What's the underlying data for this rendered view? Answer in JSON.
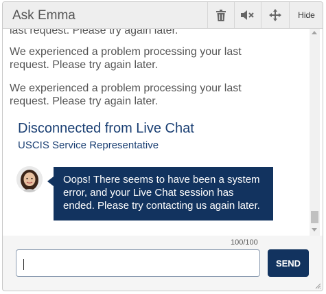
{
  "header": {
    "title": "Ask Emma",
    "hide_label": "Hide",
    "icons": [
      "trash-icon",
      "mute-icon",
      "move-icon"
    ]
  },
  "messages": [
    "last request. Please try again later.",
    "We experienced a problem processing your last request. Please try again later.",
    "We experienced a problem processing your last request. Please try again later."
  ],
  "disconnect": {
    "title": "Disconnected from Live Chat",
    "subtitle": "USCIS Service Representative"
  },
  "bot_message": "Oops! There seems to have been a system error, and your Live Chat session has ended. Please try contacting us again later.",
  "input": {
    "value": "",
    "counter": "100/100",
    "send_label": "SEND"
  },
  "colors": {
    "brand": "#12335f",
    "header_bg": "#eeeeee",
    "text": "#555555"
  }
}
